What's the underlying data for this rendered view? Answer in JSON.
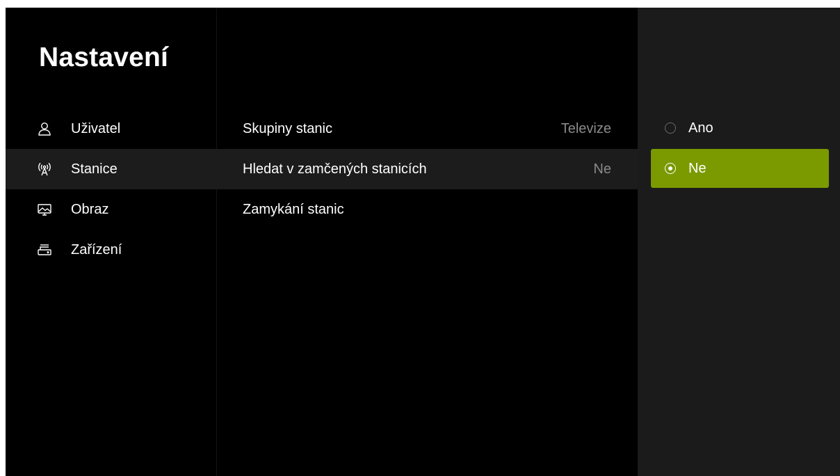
{
  "page": {
    "title": "Nastavení"
  },
  "sidebar": {
    "items": [
      {
        "label": "Uživatel",
        "icon": "user-icon"
      },
      {
        "label": "Stanice",
        "icon": "antenna-icon",
        "active": true
      },
      {
        "label": "Obraz",
        "icon": "picture-icon"
      },
      {
        "label": "Zařízení",
        "icon": "device-icon"
      }
    ]
  },
  "settings": {
    "rows": [
      {
        "label": "Skupiny stanic",
        "value": "Televize"
      },
      {
        "label": "Hledat v zamčených stanicích",
        "value": "Ne",
        "active": true
      },
      {
        "label": "Zamykání stanic",
        "value": ""
      }
    ]
  },
  "options": {
    "items": [
      {
        "label": "Ano",
        "selected": false
      },
      {
        "label": "Ne",
        "selected": true
      }
    ]
  },
  "colors": {
    "background": "#000000",
    "highlight_row": "#1c1c1c",
    "options_panel": "#1b1b1b",
    "accent": "#7a9a00",
    "muted_text": "#8a8a8a"
  }
}
